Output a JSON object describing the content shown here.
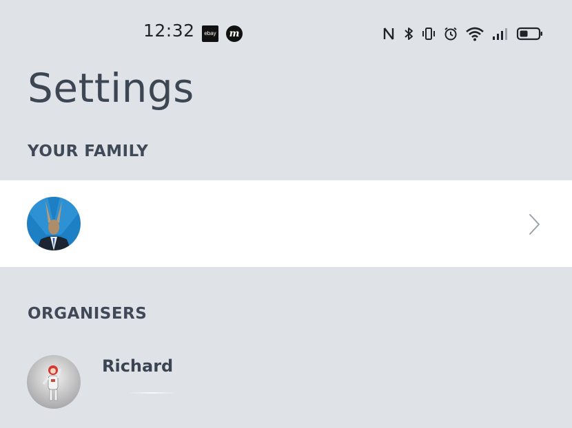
{
  "status_bar": {
    "time": "12:32",
    "app_icons": [
      {
        "name": "ebay-icon",
        "label": "ebay"
      },
      {
        "name": "m-app-icon",
        "label": "m"
      }
    ],
    "system_icons": [
      "nfc-icon",
      "bluetooth-icon",
      "vibrate-icon",
      "alarm-icon",
      "wifi-icon",
      "signal-icon",
      "battery-icon"
    ]
  },
  "page": {
    "title": "Settings"
  },
  "sections": {
    "family": {
      "header": "YOUR FAMILY"
    },
    "organisers": {
      "header": "ORGANISERS",
      "items": [
        {
          "name": "Richard"
        }
      ]
    }
  },
  "colors": {
    "background": "#dfe3e8",
    "card": "#ffffff",
    "text": "#3f4957",
    "avatar_blue": "#1d7fc4"
  }
}
